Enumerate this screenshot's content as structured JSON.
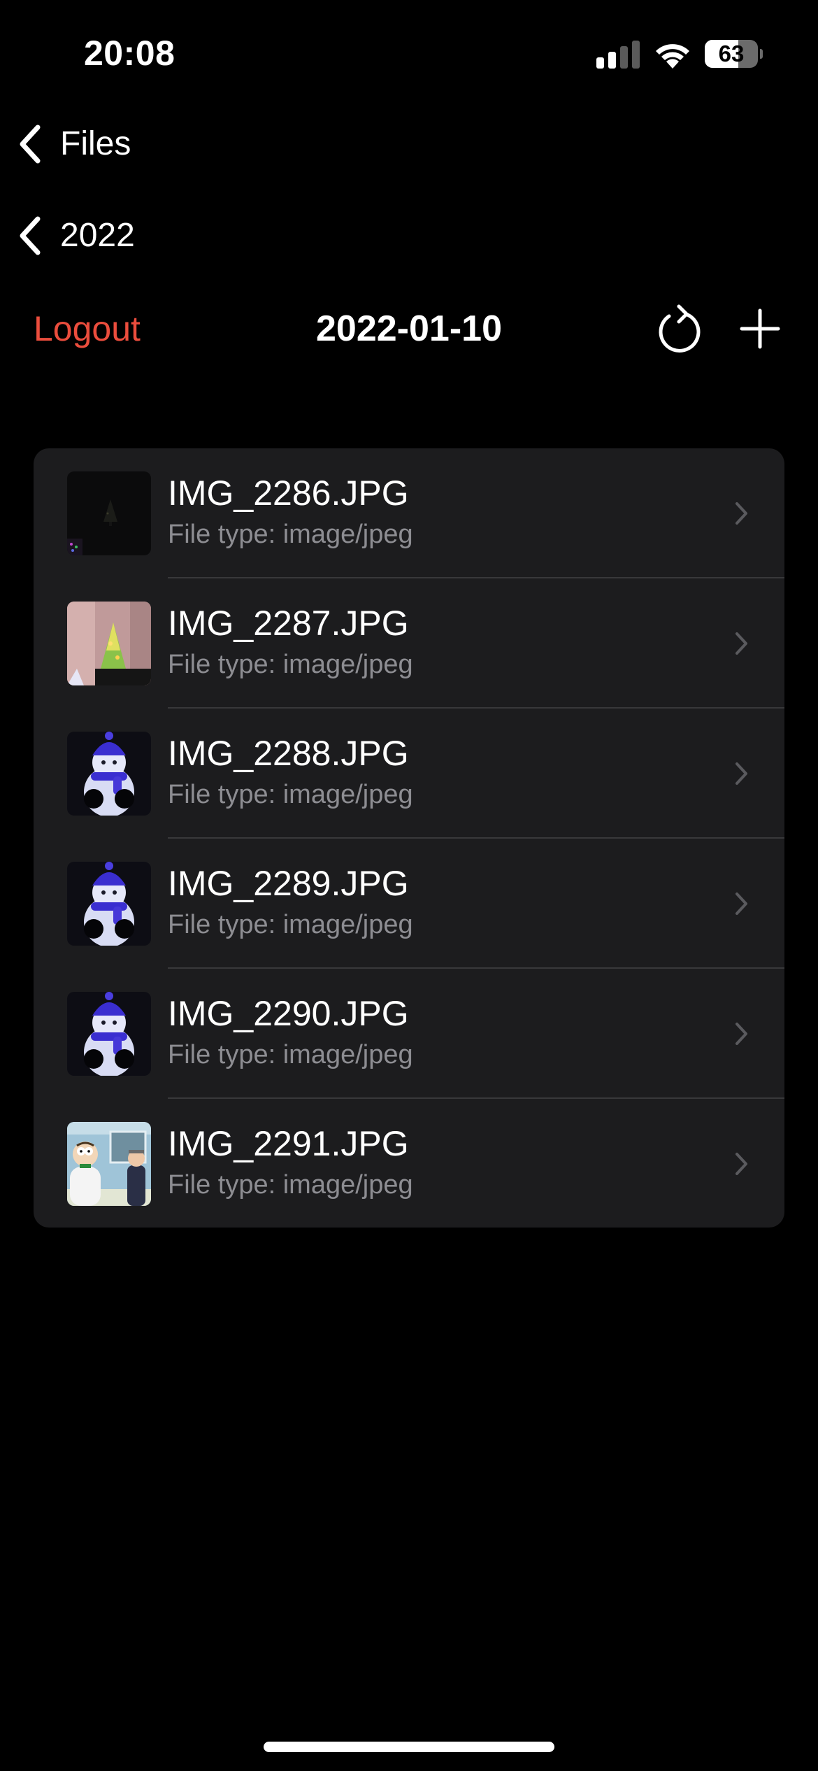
{
  "status_bar": {
    "time": "20:08",
    "battery_level": "63",
    "battery_percent": 63,
    "signal": "signal-bars-icon",
    "wifi": "wifi-icon"
  },
  "navigation": {
    "back_items": [
      {
        "label": "Files",
        "icon": "chevron-left-icon"
      },
      {
        "label": "2022",
        "icon": "chevron-left-icon"
      }
    ],
    "logout_label": "Logout",
    "title": "2022-01-10",
    "refresh_icon": "refresh-icon",
    "add_icon": "plus-icon"
  },
  "files": [
    {
      "name": "IMG_2286.JPG",
      "type": "File type: image/jpeg",
      "thumbnail": "dark-tree-thumbnail"
    },
    {
      "name": "IMG_2287.JPG",
      "type": "File type: image/jpeg",
      "thumbnail": "lit-tree-thumbnail"
    },
    {
      "name": "IMG_2288.JPG",
      "type": "File type: image/jpeg",
      "thumbnail": "snowman-thumbnail"
    },
    {
      "name": "IMG_2289.JPG",
      "type": "File type: image/jpeg",
      "thumbnail": "snowman-thumbnail"
    },
    {
      "name": "IMG_2290.JPG",
      "type": "File type: image/jpeg",
      "thumbnail": "snowman-thumbnail"
    },
    {
      "name": "IMG_2291.JPG",
      "type": "File type: image/jpeg",
      "thumbnail": "cartoon-thumbnail"
    }
  ],
  "colors": {
    "background": "#000000",
    "list_background": "#1c1c1e",
    "accent_red": "#eb4d3d",
    "secondary_text": "#8d8d92",
    "separator": "#38383a"
  }
}
